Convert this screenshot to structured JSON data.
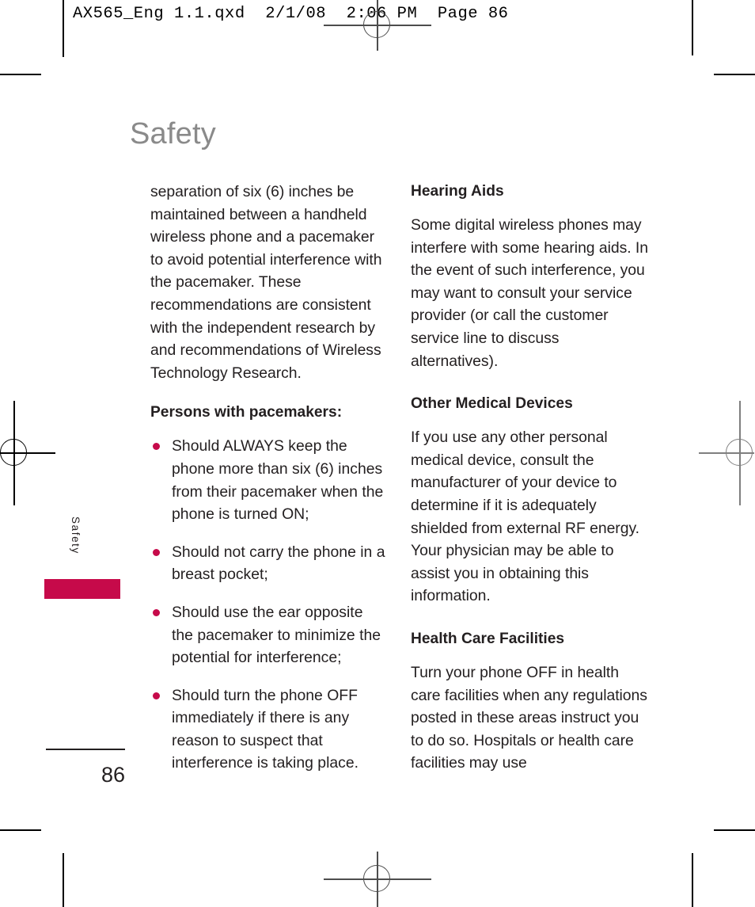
{
  "print_header": "AX565_Eng 1.1.qxd  2/1/08  2:06 PM  Page 86",
  "colors": {
    "accent": "#C60A4A",
    "title_gray": "#8A8A8A",
    "text": "#231F20"
  },
  "page": {
    "title": "Safety",
    "side_tab_label": "Safety",
    "folio": "86"
  },
  "left_column": {
    "intro_paragraph": "separation of six (6) inches be maintained between a handheld wireless phone and a pacemaker to avoid potential interference with the pacemaker. These recommendations are consistent with the independent research by and recommendations of Wireless Technology Research.",
    "bullets_heading": "Persons with pacemakers:",
    "bullets": [
      "Should ALWAYS keep the phone more than six (6) inches from their pacemaker when the phone is turned ON;",
      "Should not carry the phone in a breast pocket;",
      "Should use the ear opposite the pacemaker to minimize the potential for interference;",
      "Should turn the phone OFF immediately if there is any reason to suspect that interference is taking place."
    ]
  },
  "right_column": {
    "sections": [
      {
        "heading": "Hearing Aids",
        "body": "Some digital wireless phones may interfere with some hearing aids. In the event of such interference, you may want to consult your service provider (or call the customer service line to discuss alternatives)."
      },
      {
        "heading": "Other Medical Devices",
        "body": "If you use any other personal medical device, consult the manufacturer of your device to determine if it is adequately shielded from external RF energy. Your physician may be able to assist you in obtaining this information."
      },
      {
        "heading": "Health Care Facilities",
        "body": "Turn your phone OFF in health care facilities when any regulations posted in these areas instruct you to do so. Hospitals or health care facilities may use"
      }
    ]
  }
}
